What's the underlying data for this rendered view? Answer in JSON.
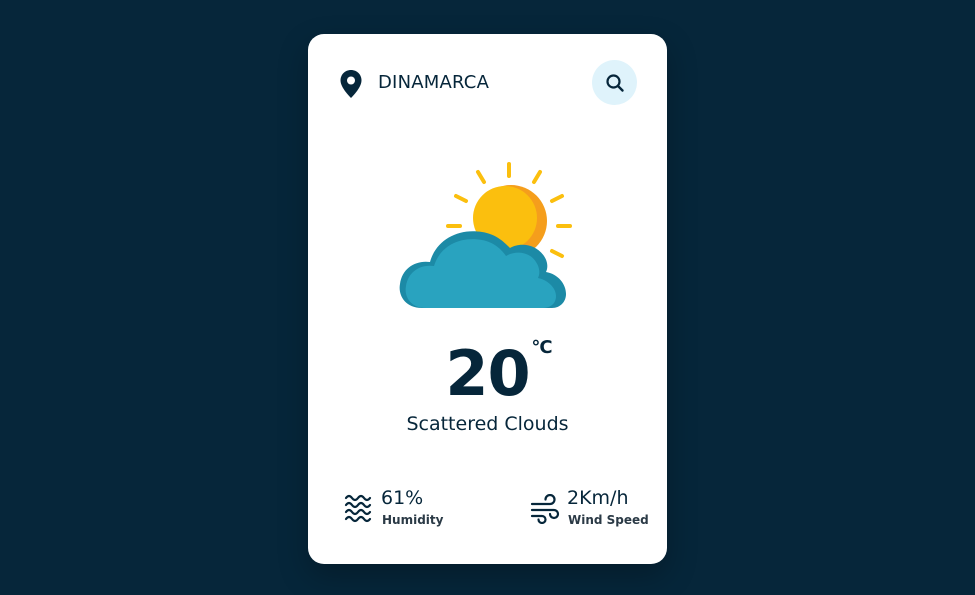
{
  "location": {
    "name": "DINAMARCA",
    "icon": "map-pin-icon"
  },
  "search": {
    "icon": "search-icon"
  },
  "weather": {
    "icon": "partly-cloudy-icon",
    "temperature": "20",
    "unit": "°C",
    "description": "Scattered Clouds"
  },
  "stats": {
    "humidity": {
      "value": "61%",
      "label": "Humidity",
      "icon": "humidity-waves-icon"
    },
    "wind": {
      "value": "2Km/h",
      "label": "Wind Speed",
      "icon": "wind-icon"
    }
  },
  "colors": {
    "background": "#06263a",
    "card": "#ffffff",
    "text": "#06263a",
    "search_bg": "#dff3fb",
    "sun": "#fbbf0e",
    "sun_shade": "#f59e1c",
    "cloud": "#29a3bf",
    "cloud_shade": "#1c8aa6"
  }
}
